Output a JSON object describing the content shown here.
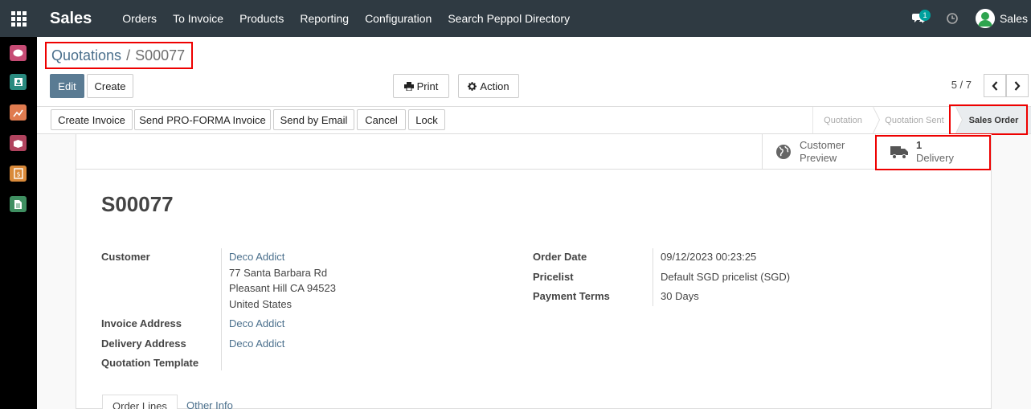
{
  "app": {
    "title": "Sales",
    "menu": [
      "Orders",
      "To Invoice",
      "Products",
      "Reporting",
      "Configuration",
      "Search Peppol Directory"
    ],
    "chat_count": "1",
    "user": "Sales"
  },
  "breadcrumb": {
    "parent": "Quotations",
    "separator": "/",
    "current": "S00077"
  },
  "toolbar": {
    "edit": "Edit",
    "create": "Create",
    "print": "Print",
    "action": "Action",
    "pager": "5 / 7"
  },
  "status_actions": [
    "Create Invoice",
    "Send PRO-FORMA Invoice",
    "Send by Email",
    "Cancel",
    "Lock"
  ],
  "stages": {
    "quotation": "Quotation",
    "sent": "Quotation Sent",
    "order": "Sales Order"
  },
  "smart_buttons": {
    "preview_line1": "Customer",
    "preview_line2": "Preview",
    "delivery_count": "1",
    "delivery_label": "Delivery"
  },
  "record": {
    "name": "S00077",
    "labels": {
      "customer": "Customer",
      "invoice_address": "Invoice Address",
      "delivery_address": "Delivery Address",
      "quotation_template": "Quotation Template",
      "order_date": "Order Date",
      "pricelist": "Pricelist",
      "payment_terms": "Payment Terms"
    },
    "customer": "Deco Addict",
    "address_line1": "77 Santa Barbara Rd",
    "address_line2": "Pleasant Hill CA 94523",
    "address_line3": "United States",
    "invoice_address": "Deco Addict",
    "delivery_address": "Deco Addict",
    "order_date": "09/12/2023 00:23:25",
    "pricelist": "Default SGD pricelist (SGD)",
    "payment_terms": "30 Days"
  },
  "tabs": {
    "order_lines": "Order Lines",
    "other_info": "Other Info"
  },
  "colors": {
    "navbar": "#2f3a42",
    "primary": "#5a7b93",
    "link": "#4a6f8c",
    "highlight": "#ee0000"
  }
}
